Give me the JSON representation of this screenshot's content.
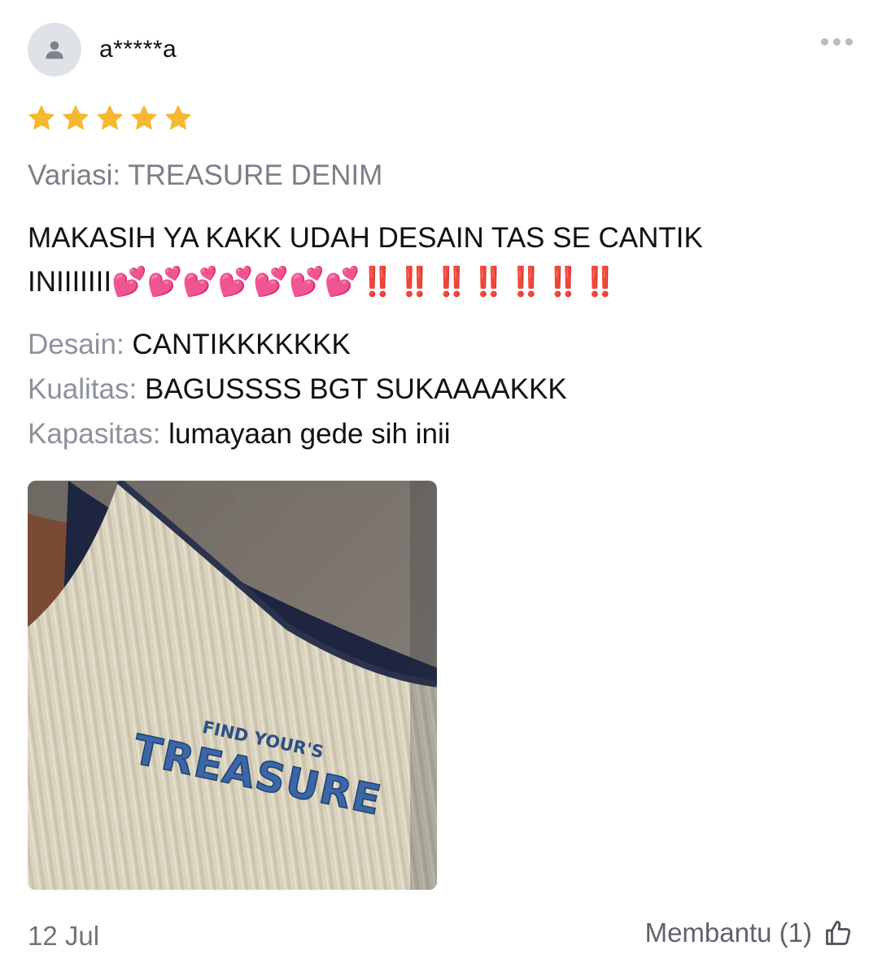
{
  "review": {
    "username": "a*****a",
    "rating": 5,
    "rating_max": 5,
    "variation": "Variasi: TREASURE DENIM",
    "text_line1": "MAKASIH YA KAKK UDAH DESAIN TAS SE CANTIK",
    "text_line2": "INIIIIIII",
    "text_hearts": "💕💕💕💕💕💕💕",
    "text_bangs": "‼️‼️‼️‼️‼️‼️‼️",
    "attributes": [
      {
        "label": "Desain:",
        "value": "CANTIKKKKKKK"
      },
      {
        "label": "Kualitas:",
        "value": "BAGUSSSS BGT SUKAAAAKKK"
      },
      {
        "label": "Kapasitas:",
        "value": "lumayaan gede sih inii"
      }
    ],
    "photo": {
      "embroidery_small": "FIND YOUR'S",
      "embroidery_large": "TREASURE"
    },
    "date": "12 Jul",
    "helpful_label": "Membantu (1)"
  },
  "icons": {
    "avatar": "person-icon",
    "more": "more-dots-icon",
    "star": "star-icon",
    "like": "thumbs-up-icon"
  },
  "colors": {
    "star": "#f5b82e",
    "muted_text": "#7a7f87",
    "avatar_bg": "#dfe3e8"
  }
}
